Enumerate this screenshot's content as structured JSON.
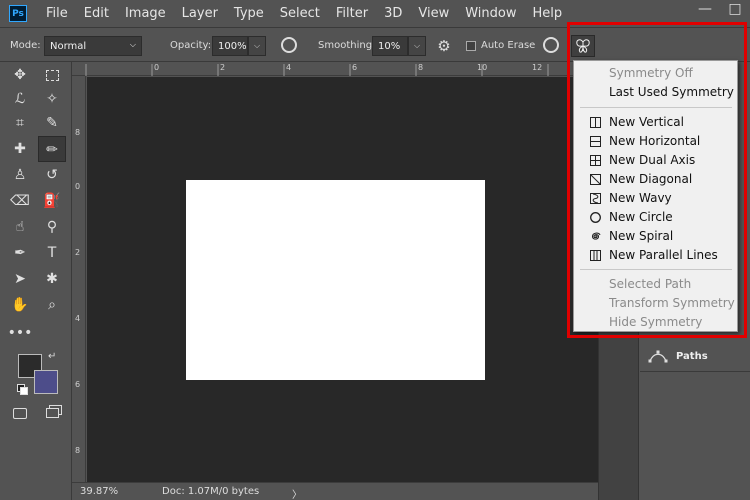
{
  "app": {
    "logo": "Ps"
  },
  "menubar": {
    "items": [
      "File",
      "Edit",
      "Image",
      "Layer",
      "Type",
      "Select",
      "Filter",
      "3D",
      "View",
      "Window",
      "Help"
    ]
  },
  "window_controls": {
    "minimize": "—",
    "restore": "□"
  },
  "options": {
    "mode_label": "Mode:",
    "mode_value": "Normal",
    "opacity_label": "Opacity:",
    "opacity_value": "100%",
    "smoothing_label": "Smoothing:",
    "smoothing_value": "10%",
    "auto_erase_label": "Auto Erase"
  },
  "ruler_top": {
    "ticks": [
      "0",
      "2",
      "4",
      "6",
      "8",
      "10",
      "12"
    ]
  },
  "ruler_left": {
    "ticks": [
      "8",
      "0",
      "2",
      "4",
      "6",
      "8"
    ]
  },
  "status": {
    "zoom": "39.87%",
    "doc": "Doc: 1.07M/0 bytes",
    "arrow": "〉"
  },
  "panels": {
    "paths_label": "Paths"
  },
  "symmetry_menu": {
    "groups": [
      [
        {
          "label": "Symmetry Off",
          "enabled": false,
          "icon": ""
        },
        {
          "label": "Last Used Symmetry",
          "enabled": true,
          "icon": ""
        }
      ],
      [
        {
          "label": "New Vertical",
          "enabled": true,
          "icon": "vertical-icon"
        },
        {
          "label": "New Horizontal",
          "enabled": true,
          "icon": "horizontal-icon"
        },
        {
          "label": "New Dual Axis",
          "enabled": true,
          "icon": "dual-axis-icon"
        },
        {
          "label": "New Diagonal",
          "enabled": true,
          "icon": "diagonal-icon"
        },
        {
          "label": "New Wavy",
          "enabled": true,
          "icon": "wavy-icon"
        },
        {
          "label": "New Circle",
          "enabled": true,
          "icon": "circle-icon"
        },
        {
          "label": "New Spiral",
          "enabled": true,
          "icon": "spiral-icon"
        },
        {
          "label": "New Parallel Lines",
          "enabled": true,
          "icon": "parallel-lines-icon"
        }
      ],
      [
        {
          "label": "Selected Path",
          "enabled": false,
          "icon": ""
        },
        {
          "label": "Transform Symmetry",
          "enabled": false,
          "icon": ""
        },
        {
          "label": "Hide Symmetry",
          "enabled": false,
          "icon": ""
        }
      ]
    ]
  },
  "colors": {
    "foreground": "#2b2b2b",
    "background": "#4d4d8a",
    "highlight": "#e00000"
  }
}
